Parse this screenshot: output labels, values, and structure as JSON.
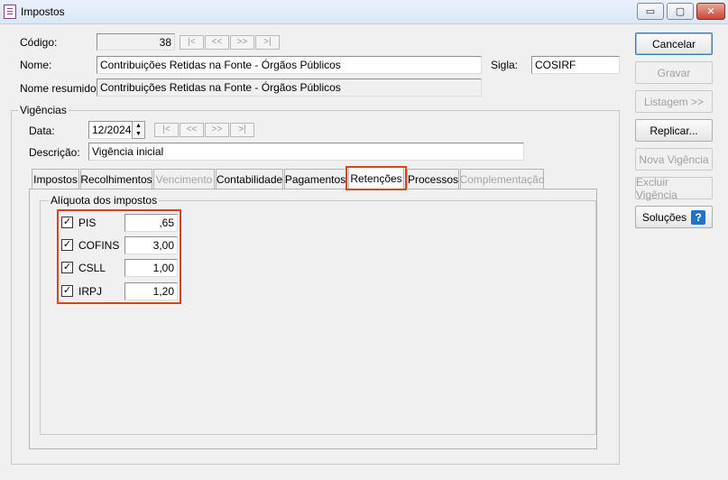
{
  "window": {
    "title": "Impostos",
    "minimize": "▭",
    "maximize": "▢",
    "close": "✕"
  },
  "header": {
    "codigo_label": "Código:",
    "codigo_value": "38",
    "nome_label": "Nome:",
    "nome_value": "Contribuições Retidas na Fonte - Órgãos Públicos",
    "sigla_label": "Sigla:",
    "sigla_value": "COSIRF",
    "nome_resumido_label": "Nome resumido:",
    "nome_resumido_value": "Contribuições Retidas na Fonte - Órgãos Públicos"
  },
  "nav": {
    "first": "|<",
    "prev": "<<",
    "next": ">>",
    "last": ">|"
  },
  "side_buttons": {
    "cancelar": "Cancelar",
    "gravar": "Gravar",
    "listagem": "Listagem >>",
    "replicar": "Replicar...",
    "nova_vigencia": "Nova Vigência",
    "excluir_vigencia": "Excluir Vigência",
    "solucoes": "Soluções",
    "help": "?"
  },
  "vigencias": {
    "title": "Vigências",
    "data_label": "Data:",
    "data_value": "12/2024",
    "spin_up": "▲",
    "spin_down": "▼",
    "descricao_label": "Descrição:",
    "descricao_value": "Vigência inicial"
  },
  "tabs": [
    {
      "label": "Impostos",
      "state": "normal"
    },
    {
      "label": "Recolhimentos",
      "state": "normal"
    },
    {
      "label": "Vencimento",
      "state": "disabled"
    },
    {
      "label": "Contabilidade",
      "state": "normal"
    },
    {
      "label": "Pagamentos",
      "state": "normal"
    },
    {
      "label": "Retenções",
      "state": "active"
    },
    {
      "label": "Processos",
      "state": "normal"
    },
    {
      "label": "Complementação",
      "state": "disabled"
    }
  ],
  "aliquota": {
    "title": "Alíquota dos impostos",
    "items": [
      {
        "name": "PIS",
        "checked": true,
        "value": ",65"
      },
      {
        "name": "COFINS",
        "checked": true,
        "value": "3,00"
      },
      {
        "name": "CSLL",
        "checked": true,
        "value": "1,00"
      },
      {
        "name": "IRPJ",
        "checked": true,
        "value": "1,20"
      }
    ],
    "check_mark": "✓"
  },
  "colors": {
    "highlight": "#d2461a",
    "help_icon": "#1f73c8"
  }
}
